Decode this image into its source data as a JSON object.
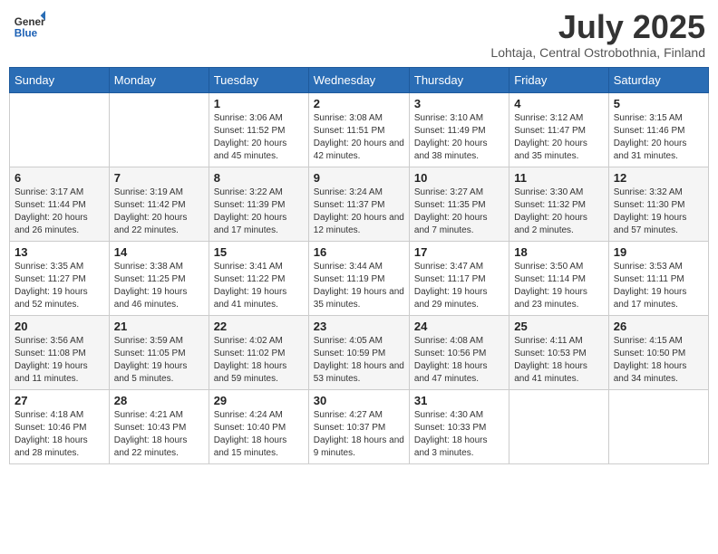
{
  "header": {
    "logo_general": "General",
    "logo_blue": "Blue",
    "month": "July 2025",
    "location": "Lohtaja, Central Ostrobothnia, Finland"
  },
  "days_of_week": [
    "Sunday",
    "Monday",
    "Tuesday",
    "Wednesday",
    "Thursday",
    "Friday",
    "Saturday"
  ],
  "weeks": [
    [
      {
        "day": "",
        "info": ""
      },
      {
        "day": "",
        "info": ""
      },
      {
        "day": "1",
        "info": "Sunrise: 3:06 AM\nSunset: 11:52 PM\nDaylight: 20 hours and 45 minutes."
      },
      {
        "day": "2",
        "info": "Sunrise: 3:08 AM\nSunset: 11:51 PM\nDaylight: 20 hours and 42 minutes."
      },
      {
        "day": "3",
        "info": "Sunrise: 3:10 AM\nSunset: 11:49 PM\nDaylight: 20 hours and 38 minutes."
      },
      {
        "day": "4",
        "info": "Sunrise: 3:12 AM\nSunset: 11:47 PM\nDaylight: 20 hours and 35 minutes."
      },
      {
        "day": "5",
        "info": "Sunrise: 3:15 AM\nSunset: 11:46 PM\nDaylight: 20 hours and 31 minutes."
      }
    ],
    [
      {
        "day": "6",
        "info": "Sunrise: 3:17 AM\nSunset: 11:44 PM\nDaylight: 20 hours and 26 minutes."
      },
      {
        "day": "7",
        "info": "Sunrise: 3:19 AM\nSunset: 11:42 PM\nDaylight: 20 hours and 22 minutes."
      },
      {
        "day": "8",
        "info": "Sunrise: 3:22 AM\nSunset: 11:39 PM\nDaylight: 20 hours and 17 minutes."
      },
      {
        "day": "9",
        "info": "Sunrise: 3:24 AM\nSunset: 11:37 PM\nDaylight: 20 hours and 12 minutes."
      },
      {
        "day": "10",
        "info": "Sunrise: 3:27 AM\nSunset: 11:35 PM\nDaylight: 20 hours and 7 minutes."
      },
      {
        "day": "11",
        "info": "Sunrise: 3:30 AM\nSunset: 11:32 PM\nDaylight: 20 hours and 2 minutes."
      },
      {
        "day": "12",
        "info": "Sunrise: 3:32 AM\nSunset: 11:30 PM\nDaylight: 19 hours and 57 minutes."
      }
    ],
    [
      {
        "day": "13",
        "info": "Sunrise: 3:35 AM\nSunset: 11:27 PM\nDaylight: 19 hours and 52 minutes."
      },
      {
        "day": "14",
        "info": "Sunrise: 3:38 AM\nSunset: 11:25 PM\nDaylight: 19 hours and 46 minutes."
      },
      {
        "day": "15",
        "info": "Sunrise: 3:41 AM\nSunset: 11:22 PM\nDaylight: 19 hours and 41 minutes."
      },
      {
        "day": "16",
        "info": "Sunrise: 3:44 AM\nSunset: 11:19 PM\nDaylight: 19 hours and 35 minutes."
      },
      {
        "day": "17",
        "info": "Sunrise: 3:47 AM\nSunset: 11:17 PM\nDaylight: 19 hours and 29 minutes."
      },
      {
        "day": "18",
        "info": "Sunrise: 3:50 AM\nSunset: 11:14 PM\nDaylight: 19 hours and 23 minutes."
      },
      {
        "day": "19",
        "info": "Sunrise: 3:53 AM\nSunset: 11:11 PM\nDaylight: 19 hours and 17 minutes."
      }
    ],
    [
      {
        "day": "20",
        "info": "Sunrise: 3:56 AM\nSunset: 11:08 PM\nDaylight: 19 hours and 11 minutes."
      },
      {
        "day": "21",
        "info": "Sunrise: 3:59 AM\nSunset: 11:05 PM\nDaylight: 19 hours and 5 minutes."
      },
      {
        "day": "22",
        "info": "Sunrise: 4:02 AM\nSunset: 11:02 PM\nDaylight: 18 hours and 59 minutes."
      },
      {
        "day": "23",
        "info": "Sunrise: 4:05 AM\nSunset: 10:59 PM\nDaylight: 18 hours and 53 minutes."
      },
      {
        "day": "24",
        "info": "Sunrise: 4:08 AM\nSunset: 10:56 PM\nDaylight: 18 hours and 47 minutes."
      },
      {
        "day": "25",
        "info": "Sunrise: 4:11 AM\nSunset: 10:53 PM\nDaylight: 18 hours and 41 minutes."
      },
      {
        "day": "26",
        "info": "Sunrise: 4:15 AM\nSunset: 10:50 PM\nDaylight: 18 hours and 34 minutes."
      }
    ],
    [
      {
        "day": "27",
        "info": "Sunrise: 4:18 AM\nSunset: 10:46 PM\nDaylight: 18 hours and 28 minutes."
      },
      {
        "day": "28",
        "info": "Sunrise: 4:21 AM\nSunset: 10:43 PM\nDaylight: 18 hours and 22 minutes."
      },
      {
        "day": "29",
        "info": "Sunrise: 4:24 AM\nSunset: 10:40 PM\nDaylight: 18 hours and 15 minutes."
      },
      {
        "day": "30",
        "info": "Sunrise: 4:27 AM\nSunset: 10:37 PM\nDaylight: 18 hours and 9 minutes."
      },
      {
        "day": "31",
        "info": "Sunrise: 4:30 AM\nSunset: 10:33 PM\nDaylight: 18 hours and 3 minutes."
      },
      {
        "day": "",
        "info": ""
      },
      {
        "day": "",
        "info": ""
      }
    ]
  ]
}
